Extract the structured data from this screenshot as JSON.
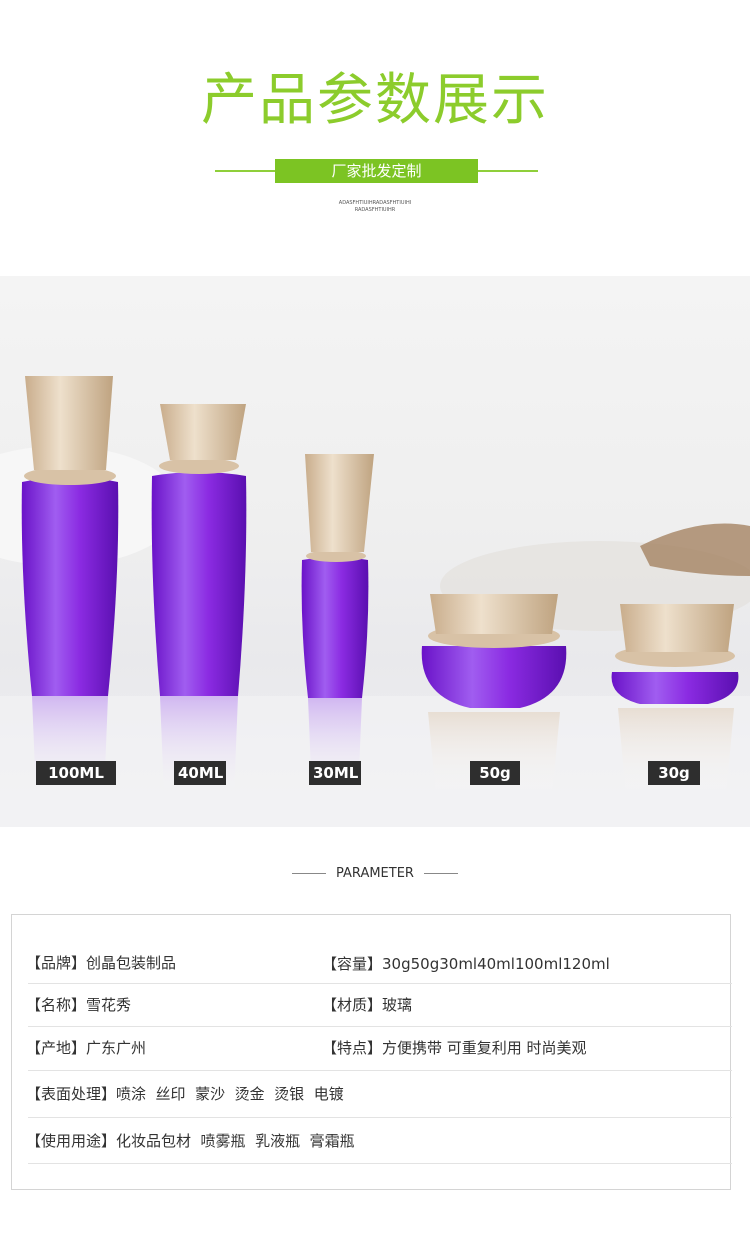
{
  "header": {
    "title": "产品参数展示",
    "subtitle_banner": "厂家批发定制",
    "tiny_line_1": "ADASFHTIUIHRADASFHTIUIHI",
    "tiny_line_2": "RADASFHTIUIHR"
  },
  "colors": {
    "title_green": "#8ccc2c",
    "banner_green": "#7cc423",
    "glass_purple": "#8b2be2",
    "cap_gold": "#d9c1a5",
    "label_bg": "#2e2e2e"
  },
  "product_labels": [
    "100ML",
    "40ML",
    "30ML",
    "50g",
    "30g"
  ],
  "parameter_section": {
    "heading": "PARAMETER",
    "rows": [
      {
        "left": {
          "label": "【品牌】",
          "value": "创晶包装制品"
        },
        "right": {
          "label": "【容量】",
          "value": "30g50g30ml40ml100ml120ml"
        }
      },
      {
        "left": {
          "label": "【名称】",
          "value": "雪花秀"
        },
        "right": {
          "label": "【材质】",
          "value": "玻璃"
        }
      },
      {
        "left": {
          "label": "【产地】",
          "value": "广东广州"
        },
        "right": {
          "label": "【特点】",
          "value": "方便携带 可重复利用 时尚美观"
        }
      },
      {
        "full": {
          "label": "【表面处理】",
          "value": "喷涂  丝印  蒙沙  烫金  烫银  电镀"
        }
      },
      {
        "full": {
          "label": "【使用用途】",
          "value": "化妆品包材  喷雾瓶  乳液瓶  膏霜瓶"
        }
      }
    ]
  }
}
